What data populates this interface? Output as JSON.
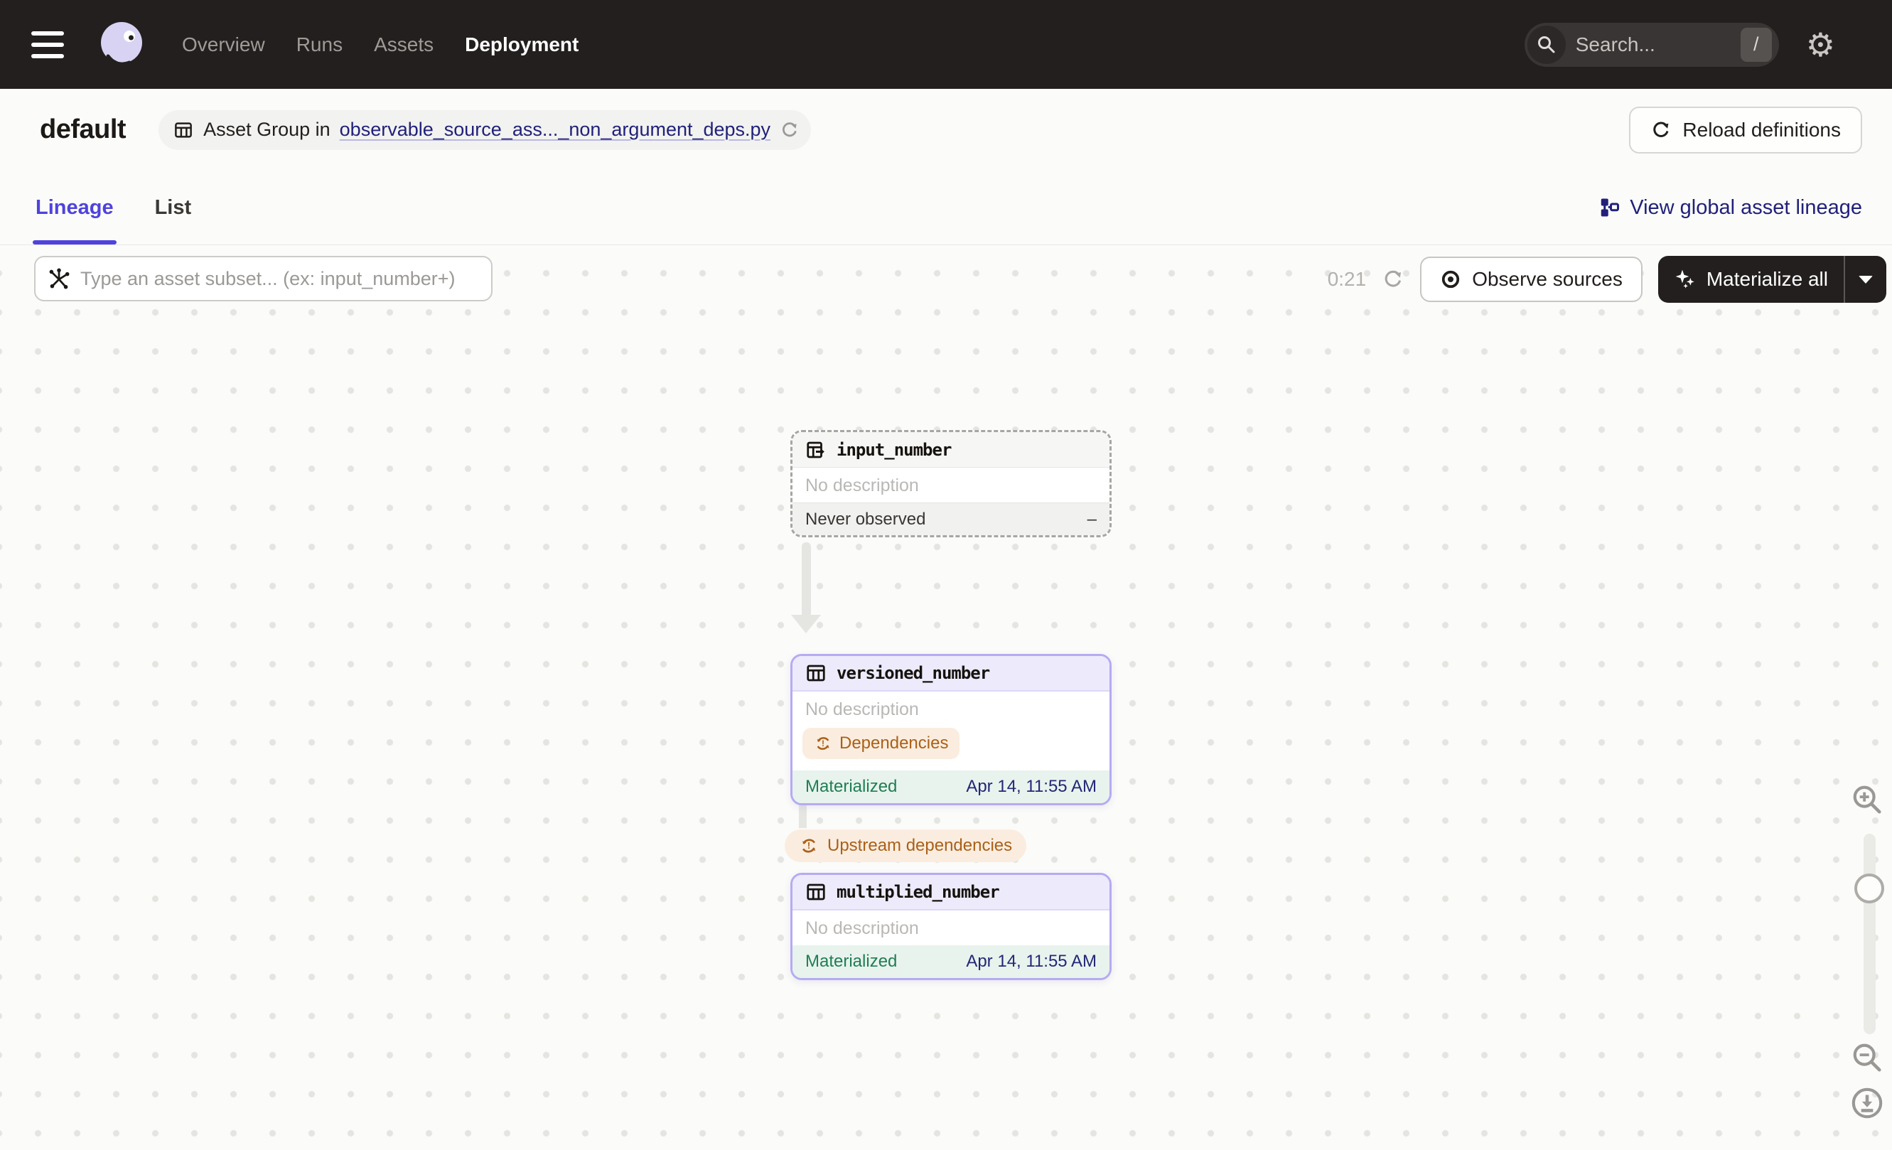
{
  "topbar": {
    "nav": [
      {
        "label": "Overview",
        "active": false
      },
      {
        "label": "Runs",
        "active": false
      },
      {
        "label": "Assets",
        "active": false
      },
      {
        "label": "Deployment",
        "active": true
      }
    ],
    "search": {
      "placeholder": "Search...",
      "shortcut": "/"
    }
  },
  "header": {
    "title": "default",
    "chip": {
      "prefix": "Asset Group in",
      "link": "observable_source_ass..._non_argument_deps.py"
    },
    "reload_button": "Reload definitions"
  },
  "tabs": {
    "items": [
      {
        "label": "Lineage",
        "active": true
      },
      {
        "label": "List",
        "active": false
      }
    ],
    "global_lineage_label": "View global asset lineage"
  },
  "toolbar": {
    "subset_placeholder": "Type an asset subset... (ex: input_number+)",
    "timer": "0:21",
    "observe_label": "Observe sources",
    "materialize_label": "Materialize all"
  },
  "graph": {
    "nodes": [
      {
        "name": "input_number",
        "type": "observable-source",
        "description": "No description",
        "status_label": "Never observed",
        "status_value": "–"
      },
      {
        "name": "versioned_number",
        "type": "asset",
        "description": "No description",
        "badge_label": "Dependencies",
        "status_label": "Materialized",
        "status_value": "Apr 14, 11:55 AM"
      },
      {
        "name": "multiplied_number",
        "type": "asset",
        "description": "No description",
        "status_label": "Materialized",
        "status_value": "Apr 14, 11:55 AM"
      }
    ],
    "edge_badge_label": "Upstream dependencies"
  },
  "colors": {
    "accent": "#4F43DD",
    "link_navy": "#21217A",
    "materialized_green": "#1F7E52",
    "warning_orange": "#AB6018",
    "warning_bg": "#FAEDE0",
    "node_purple_border": "#B5ABF2",
    "topbar_bg": "#231F1E"
  }
}
